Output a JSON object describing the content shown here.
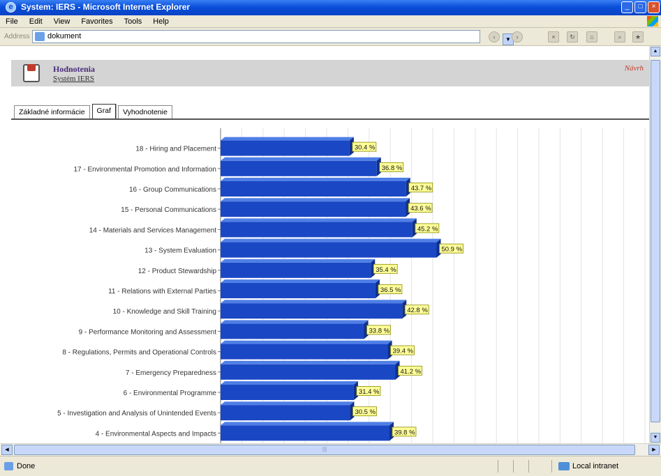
{
  "window": {
    "title": "System: IERS - Microsoft Internet Explorer",
    "controls": [
      "_",
      "□",
      "×"
    ]
  },
  "menu": [
    "File",
    "Edit",
    "View",
    "Favorites",
    "Tools",
    "Help"
  ],
  "address": {
    "label": "Address",
    "value": "dokument"
  },
  "toolbar_icons": [
    "back-icon",
    "forward-icon",
    "stop-icon",
    "refresh-icon",
    "home-icon",
    "search-icon",
    "favorites-icon"
  ],
  "header": {
    "title": "Hodnotenia",
    "subtitle": "Systém IERS",
    "right_link": "Návrh"
  },
  "tabs": [
    {
      "label": "Základné informácie",
      "active": false
    },
    {
      "label": "Graf",
      "active": true
    },
    {
      "label": "Vyhodnotenie",
      "active": false
    }
  ],
  "chart_data": {
    "type": "bar",
    "orientation": "horizontal",
    "categories": [
      "18 - Hiring and Placement",
      "17 - Environmental Promotion and Information",
      "16 - Group Communications",
      "15 - Personal Communications",
      "14 - Materials and Services Management",
      "13 - System Evaluation",
      "12 - Product Stewardship",
      "11 - Relations with External Parties",
      "10 - Knowledge and Skill Training",
      "9 - Performance Monitoring and Assessment",
      "8 - Regulations, Permits and Operational Controls",
      "7 - Emergency Preparedness",
      "6 - Environmental Programme",
      "5 - Investigation and Analysis of Unintended Events",
      "4 - Environmental Aspects and Impacts"
    ],
    "values": [
      30.4,
      36.8,
      43.7,
      43.6,
      45.2,
      50.9,
      35.4,
      36.5,
      42.8,
      33.8,
      39.4,
      41.2,
      31.4,
      30.5,
      39.8
    ],
    "value_labels": [
      "30.4 %",
      "36.8 %",
      "43.7 %",
      "43.6 %",
      "45.2 %",
      "50.9 %",
      "35.4 %",
      "36.5 %",
      "42.8 %",
      "33.8 %",
      "39.4 %",
      "41.2 %",
      "31.4 %",
      "30.5 %",
      "39.8 %"
    ],
    "xlim": [
      0,
      100
    ],
    "grid": true,
    "bar_color": "#1a47c4",
    "label_bg": "#ffff99"
  },
  "status": {
    "text": "Done",
    "zone": "Local intranet"
  }
}
